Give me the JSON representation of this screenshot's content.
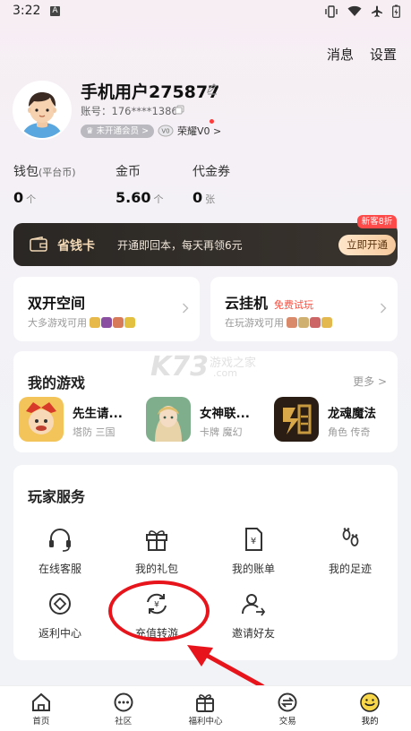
{
  "status_bar": {
    "time": "3:22",
    "notification_badge": "A"
  },
  "header": {
    "messages": "消息",
    "settings": "设置"
  },
  "profile": {
    "username": "手机用户275877",
    "account": "账号：176****1386",
    "vip_badge": "未开通会员 >",
    "honor": "荣耀V0 >"
  },
  "stats": [
    {
      "label": "钱包",
      "sub": "(平台币)",
      "value": "0",
      "unit": "个"
    },
    {
      "label": "金币",
      "sub": "",
      "value": "5.60",
      "unit": "个"
    },
    {
      "label": "代金券",
      "sub": "",
      "value": "0",
      "unit": "张"
    }
  ],
  "save_card": {
    "title": "省钱卡",
    "desc": "开通即回本，每天再领6元",
    "button": "立即开通",
    "tag": "新客8折"
  },
  "dual_space": {
    "title": "双开空间",
    "desc": "大多游戏可用"
  },
  "cloud_hang": {
    "title": "云挂机",
    "badge": "免费试玩",
    "desc": "在玩游戏可用"
  },
  "my_games": {
    "title": "我的游戏",
    "more": "更多 >",
    "items": [
      {
        "name": "先生请...",
        "tags": "塔防 三国"
      },
      {
        "name": "女神联...",
        "tags": "卡牌 魔幻"
      },
      {
        "name": "龙魂魔法",
        "tags": "角色 传奇"
      }
    ]
  },
  "services": {
    "title": "玩家服务",
    "items": [
      {
        "label": "在线客服",
        "icon": "headset-icon"
      },
      {
        "label": "我的礼包",
        "icon": "gift-icon"
      },
      {
        "label": "我的账单",
        "icon": "bill-icon"
      },
      {
        "label": "我的足迹",
        "icon": "footprint-icon"
      },
      {
        "label": "返利中心",
        "icon": "rebate-icon"
      },
      {
        "label": "充值转游",
        "icon": "recharge-transfer-icon"
      },
      {
        "label": "邀请好友",
        "icon": "invite-icon"
      }
    ]
  },
  "watermark": {
    "brand": "K73",
    "text": "游戏之家",
    "domain": ".com"
  },
  "tabbar": [
    {
      "label": "首页",
      "icon": "home-icon"
    },
    {
      "label": "社区",
      "icon": "community-icon"
    },
    {
      "label": "福利中心",
      "icon": "welfare-icon"
    },
    {
      "label": "交易",
      "icon": "trade-icon"
    },
    {
      "label": "我的",
      "icon": "me-icon"
    }
  ],
  "colors": {
    "accent_red": "#e8141c",
    "gold": "#f6c99c",
    "dark_card": "#2a2724"
  }
}
